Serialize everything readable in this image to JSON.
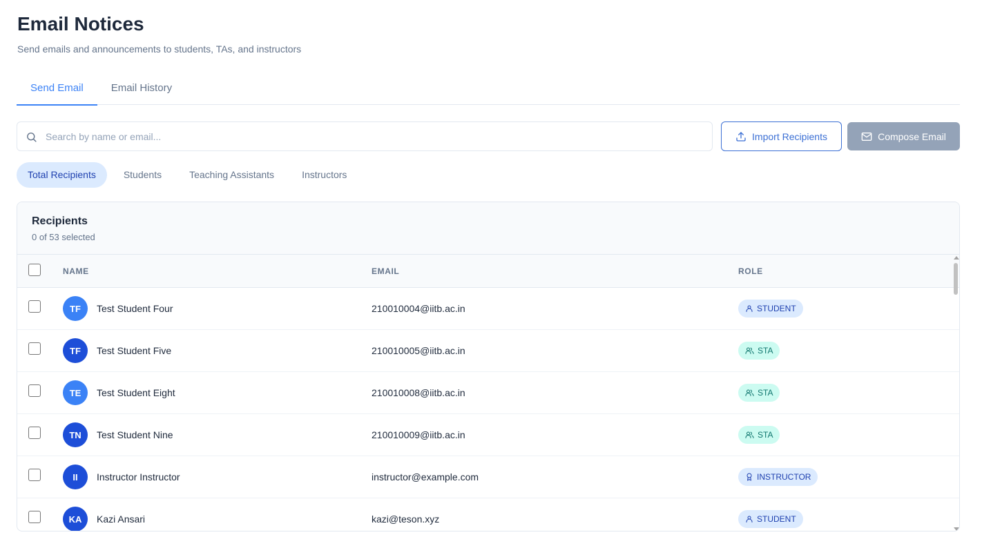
{
  "page": {
    "title": "Email Notices",
    "subtitle": "Send emails and announcements to students, TAs, and instructors"
  },
  "tabs": [
    {
      "label": "Send Email",
      "active": true
    },
    {
      "label": "Email History",
      "active": false
    }
  ],
  "search": {
    "placeholder": "Search by name or email...",
    "value": ""
  },
  "actions": {
    "import_label": "Import Recipients",
    "compose_label": "Compose Email"
  },
  "filters": [
    {
      "label": "Total Recipients",
      "active": true
    },
    {
      "label": "Students",
      "active": false
    },
    {
      "label": "Teaching Assistants",
      "active": false
    },
    {
      "label": "Instructors",
      "active": false
    }
  ],
  "recipients": {
    "title": "Recipients",
    "count_text": "0 of 53 selected",
    "columns": {
      "name": "NAME",
      "email": "EMAIL",
      "role": "ROLE"
    },
    "rows": [
      {
        "initials": "TF",
        "name": "Test Student Four",
        "email": "210010004@iitb.ac.in",
        "role": "STUDENT",
        "avatar_color": "#3b82f6"
      },
      {
        "initials": "TF",
        "name": "Test Student Five",
        "email": "210010005@iitb.ac.in",
        "role": "STA",
        "avatar_color": "#1d4ed8"
      },
      {
        "initials": "TE",
        "name": "Test Student Eight",
        "email": "210010008@iitb.ac.in",
        "role": "STA",
        "avatar_color": "#3b82f6"
      },
      {
        "initials": "TN",
        "name": "Test Student Nine",
        "email": "210010009@iitb.ac.in",
        "role": "STA",
        "avatar_color": "#1d4ed8"
      },
      {
        "initials": "II",
        "name": "Instructor Instructor",
        "email": "instructor@example.com",
        "role": "INSTRUCTOR",
        "avatar_color": "#1d4ed8"
      },
      {
        "initials": "KA",
        "name": "Kazi Ansari",
        "email": "kazi@teson.xyz",
        "role": "STUDENT",
        "avatar_color": "#1d4ed8"
      }
    ]
  },
  "colors": {
    "accent": "#3b82f6",
    "compose_disabled": "#94a3b8",
    "sta_badge_bg": "#ccfbf1",
    "student_badge_bg": "#dbeafe"
  },
  "icons": {
    "search": "search-icon",
    "import": "upload-icon",
    "compose": "mail-icon",
    "student": "user-icon",
    "sta": "users-icon",
    "instructor": "award-icon"
  }
}
